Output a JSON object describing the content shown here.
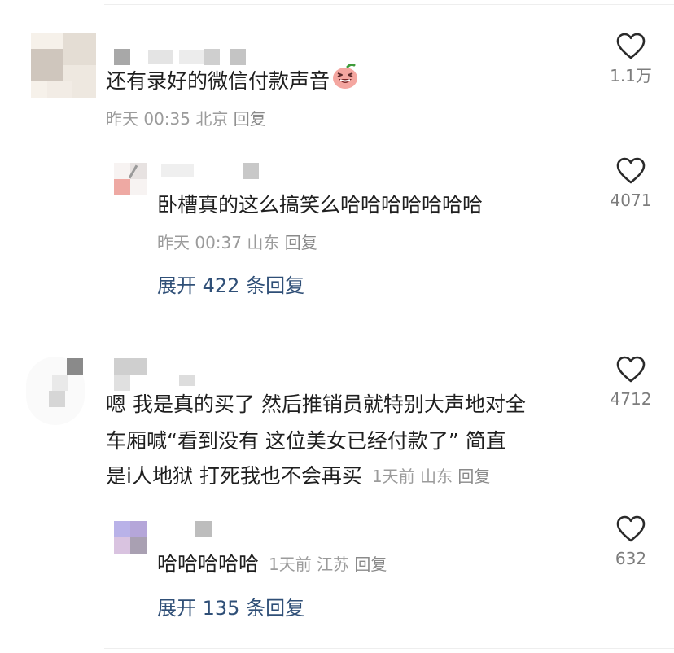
{
  "comments": [
    {
      "text": "还有录好的微信付款声音",
      "emoji": "grinning-face-emoji",
      "time": "昨天 00:35",
      "location": "北京",
      "reply_label": "回复",
      "likes": "1.1万",
      "reply": {
        "text": "卧槽真的这么搞笑么哈哈哈哈哈哈哈",
        "time": "昨天 00:37",
        "location": "山东",
        "reply_label": "回复",
        "likes": "4071"
      },
      "expand_label": "展开 422 条回复"
    },
    {
      "text_lines": [
        "嗯 我是真的买了 然后推销员就特别大声地对全",
        "车厢喊“看到没有 这位美女已经付款了” 简直",
        "是i人地狱 打死我也不会再买"
      ],
      "time": "1天前",
      "location": "山东",
      "reply_label": "回复",
      "likes": "4712",
      "reply": {
        "text": "哈哈哈哈哈",
        "time": "1天前",
        "location": "江苏",
        "reply_label": "回复",
        "likes": "632"
      },
      "expand_label": "展开 135 条回复"
    }
  ],
  "colors": {
    "text": "#1f1f1f",
    "meta": "#9b9b9b",
    "expand_link": "#2f4f77",
    "like_count": "#7d7d7d",
    "divider": "#eeeeee"
  },
  "icons": [
    "heart-outline-icon"
  ]
}
